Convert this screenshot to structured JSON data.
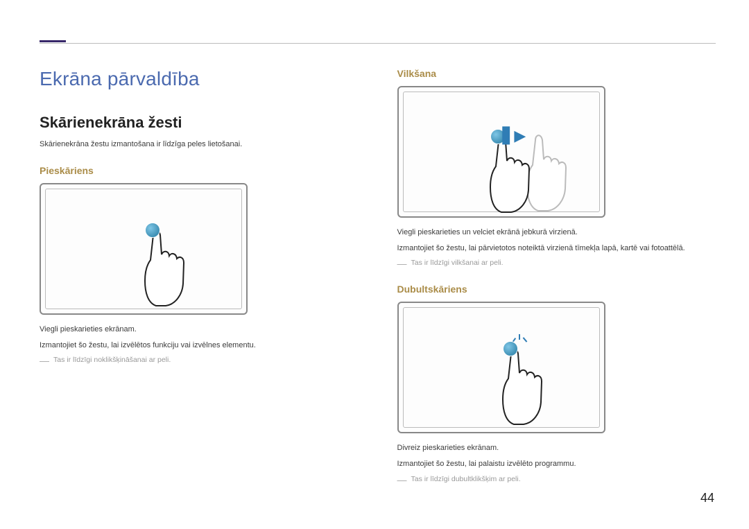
{
  "page": {
    "number": "44"
  },
  "headings": {
    "chapter": "Ekrāna pārvaldība",
    "section": "Skārienekrāna žesti",
    "intro": "Skārienekrāna žestu izmantošana ir līdzīga peles lietošanai."
  },
  "tap": {
    "title": "Pieskāriens",
    "line1": "Viegli pieskarieties ekrānam.",
    "line2": "Izmantojiet šo žestu, lai izvēlētos funkciju vai izvēlnes elementu.",
    "note": "Tas ir līdzīgi noklikšķināšanai ar peli."
  },
  "drag": {
    "title": "Vilkšana",
    "line1": "Viegli pieskarieties un velciet ekrānā jebkurā virzienā.",
    "line2": "Izmantojiet šo žestu, lai pārvietotos noteiktā virzienā tīmekļa lapā, kartē vai fotoattēlā.",
    "note": "Tas ir līdzīgi vilkšanai ar peli."
  },
  "doubletap": {
    "title": "Dubultskāriens",
    "line1": "Divreiz pieskarieties ekrānam.",
    "line2": "Izmantojiet šo žestu, lai palaistu izvēlēto programmu.",
    "note": "Tas ir līdzīgi dubultklikšķim ar peli."
  }
}
